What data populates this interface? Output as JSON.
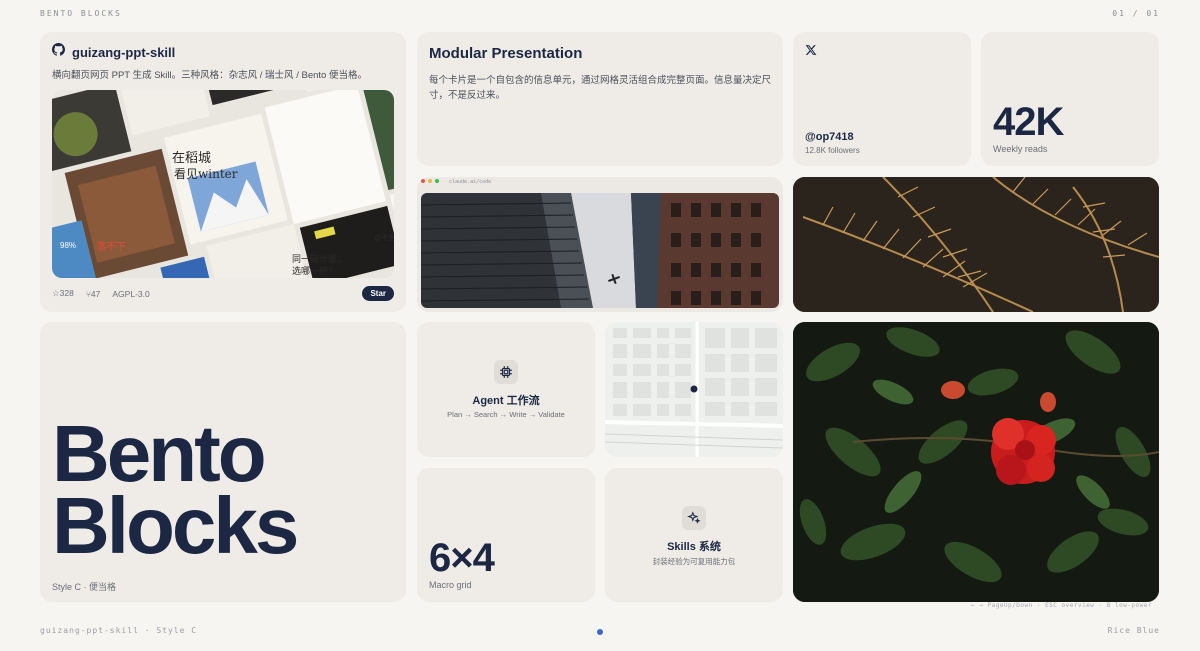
{
  "header": {
    "left": "BENTO BLOCKS",
    "right": "01 / 01"
  },
  "footer": {
    "left": "guizang-ppt-skill · Style C",
    "right": "Rice Blue",
    "hint": "← → PageUp/Down · ESC overview · B low-power"
  },
  "github_card": {
    "title": "guizang-ppt-skill",
    "description": "横向翻页网页 PPT 生成 Skill。三种风格：杂志风 / 瑞士风 / Bento 便当格。",
    "stars": "328",
    "forks": "47",
    "license": "AGPL-3.0",
    "star_button": "Star",
    "icon": "github-icon",
    "preview_texts": {
      "t1": "在稻城",
      "t2": "看见winter",
      "t3": "98%",
      "t4": "同一碗什量，",
      "t5": "选哪一杯？",
      "t6": "这卡里",
      "t7": "落不下"
    }
  },
  "modular_card": {
    "title": "Modular Presentation",
    "body": "每个卡片是一个自包含的信息单元，通过网格灵活组合成完整页面。信息量决定尺寸，不是反过来。"
  },
  "x_card": {
    "icon": "x-icon",
    "handle": "@op7418",
    "followers": "12.8K followers"
  },
  "reads_card": {
    "value": "42K",
    "label": "Weekly reads"
  },
  "browser_card": {
    "url": "claude.ai/code"
  },
  "hero_card": {
    "line1": "Bento",
    "line2": "Blocks",
    "subtitle": "Style C · 便当格"
  },
  "agent_card": {
    "icon": "cpu-icon",
    "title": "Agent 工作流",
    "subtitle": "Plan → Search → Write → Validate"
  },
  "grid_card": {
    "value": "6×4",
    "label": "Macro grid"
  },
  "skills_card": {
    "icon": "sparkle-icon",
    "title": "Skills 系统",
    "subtitle": "封装经验为可复用能力包"
  },
  "colors": {
    "ink": "#1c2744",
    "card": "#efece7",
    "bg": "#f7f5f1",
    "accent": "#3a67c9"
  }
}
